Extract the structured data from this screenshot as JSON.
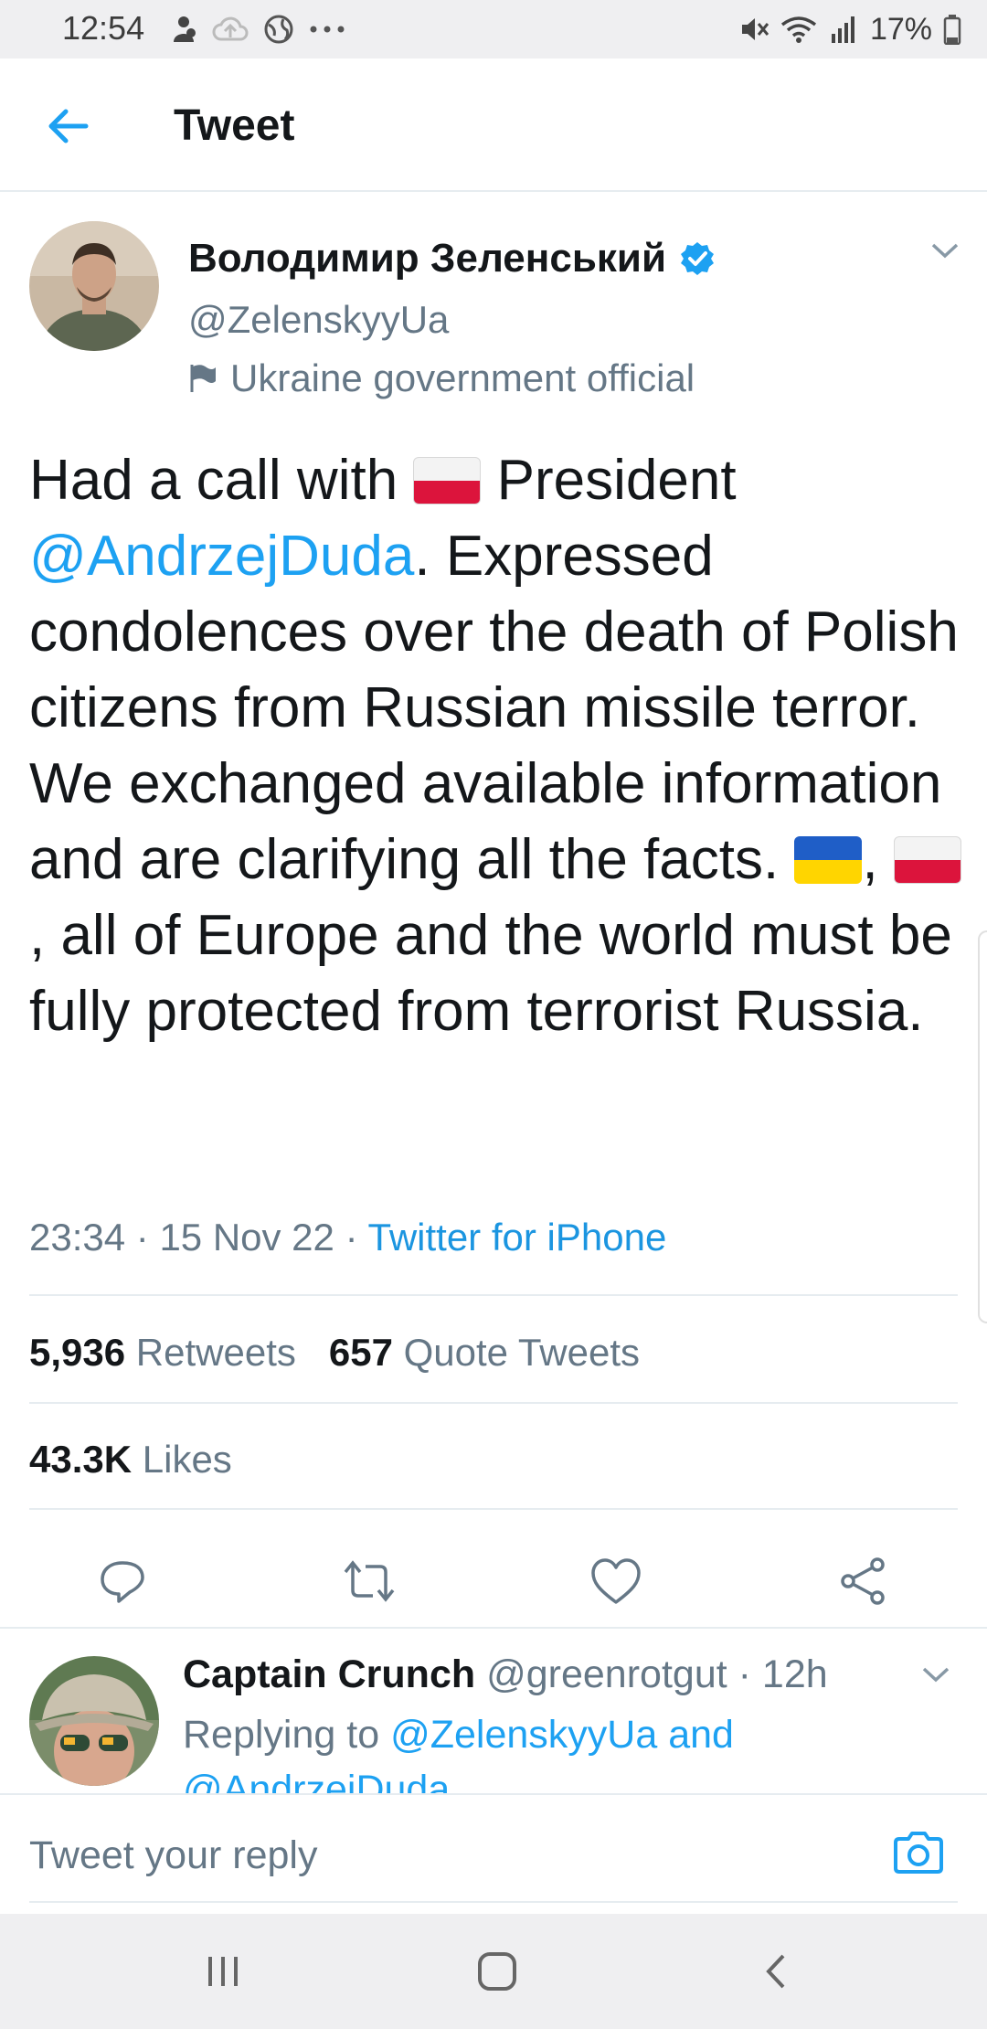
{
  "status_bar": {
    "time": "12:54",
    "battery": "17%",
    "icons": [
      "app-notification-icon",
      "cloud-upload-icon",
      "globe-icon",
      "more-dots-icon",
      "mute-icon",
      "wifi-icon",
      "signal-icon",
      "battery-icon"
    ]
  },
  "header": {
    "title": "Tweet",
    "back_icon": "arrow-left-icon"
  },
  "tweet": {
    "author_name": "Володимир Зеленський",
    "handle": "@ZelenskyyUa",
    "label": "Ukraine government official",
    "text_parts": {
      "p1": "Had a call with ",
      "p2": " President ",
      "mention": "@AndrzejDuda",
      "p3": ". Expressed condolences over the death of Polish citizens from Russian missile terror. We exchanged available information and are clarifying all the facts. ",
      "sep1": ", ",
      "sep2": ", all of Europe and the world must be fully protected from terrorist Russia."
    },
    "time": "23:34",
    "date": "15 Nov 22",
    "source": "Twitter for iPhone",
    "retweets_count": "5,936",
    "retweets_label": "Retweets",
    "quotes_count": "657",
    "quotes_label": "Quote Tweets",
    "likes_count": "43.3K",
    "likes_label": "Likes"
  },
  "reply": {
    "name": "Captain Crunch",
    "handle": "@greenrotgut",
    "age": "12h",
    "replying_prefix": "Replying to ",
    "replying_to_1": "@ZelenskyyUa",
    "and": " and",
    "replying_to_2": "@AndrzejDuda"
  },
  "compose": {
    "placeholder": "Tweet your reply"
  },
  "colors": {
    "accent": "#1DA1F2",
    "muted": "#657786",
    "text": "#14171A",
    "divider": "#E6ECF0"
  }
}
